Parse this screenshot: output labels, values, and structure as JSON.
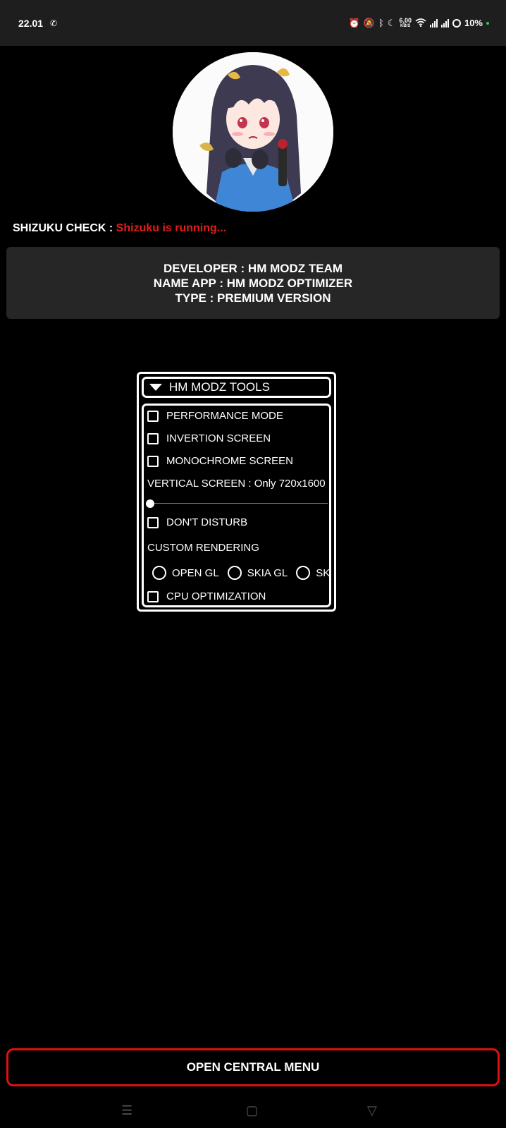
{
  "status_bar": {
    "time": "22.01",
    "data_speed": "6,00",
    "data_unit": "KB/S",
    "battery": "10%"
  },
  "shizuku": {
    "label": "SHIZUKU CHECK :",
    "status": "Shizuku is running..."
  },
  "info": {
    "developer": "DEVELOPER : HM MODZ TEAM",
    "name_app": "NAME APP : HM MODZ OPTIMIZER",
    "type": "TYPE : PREMIUM VERSION"
  },
  "tools": {
    "title": "HM MODZ TOOLS",
    "performance_mode": "PERFORMANCE MODE",
    "invertion_screen": "INVERTION SCREEN",
    "monochrome_screen": "MONOCHROME SCREEN",
    "vertical_screen": "VERTICAL SCREEN : Only 720x1600",
    "vertical_screen_value": 0,
    "dont_disturb": "DON'T DISTURB",
    "custom_rendering": "CUSTOM RENDERING",
    "render_options": [
      "OPEN GL",
      "SKIA GL",
      "SKIA"
    ],
    "cpu_optimization": "CPU OPTIMIZATION"
  },
  "central_button": "OPEN CENTRAL MENU",
  "colors": {
    "status_red": "#e11d1d",
    "button_border": "#dd1111",
    "panel_bg": "#262626"
  }
}
